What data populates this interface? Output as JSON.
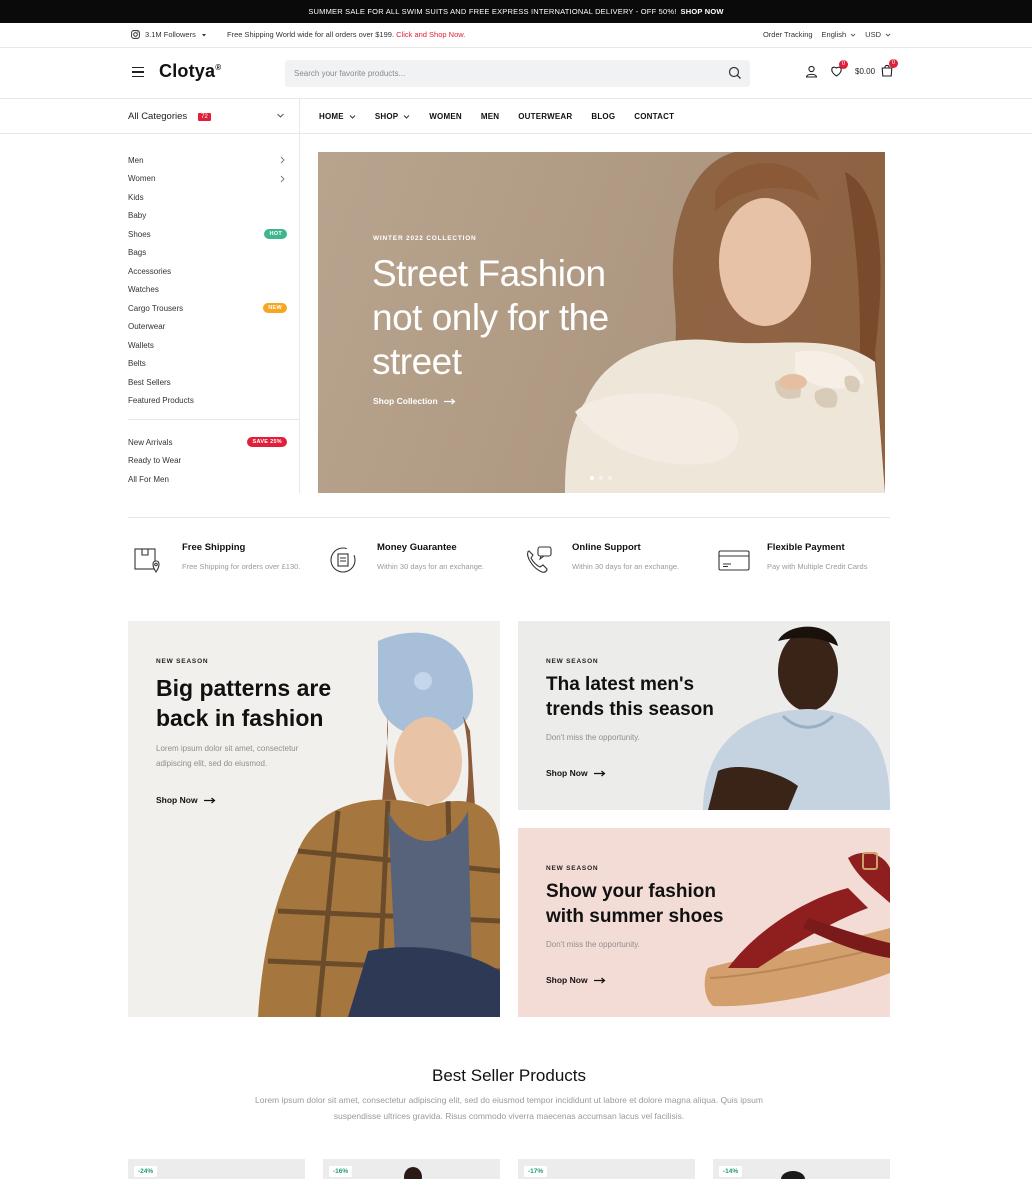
{
  "announcement": {
    "text": "Summer sale for all swim suits and free express international delivery - off 50%!",
    "cta": "Shop now"
  },
  "utility": {
    "followers": "3.1M Followers",
    "shipping_text": "Free Shipping World wide for all orders over $199.",
    "shipping_link": "Click and Shop Now.",
    "order_tracking": "Order Tracking",
    "language": "English",
    "currency": "USD"
  },
  "header": {
    "logo": "Clotya",
    "logo_mark": "®",
    "search_placeholder": "Search your favorite products...",
    "wishlist_count": "0",
    "cart_total": "$0.00",
    "cart_count": "0"
  },
  "nav": {
    "all_categories": "All Categories",
    "categories_count": "72",
    "items": [
      "Home",
      "Shop",
      "Women",
      "Men",
      "Outerwear",
      "Blog",
      "Contact"
    ]
  },
  "sidebar": {
    "categories": [
      {
        "label": "Men"
      },
      {
        "label": "Women"
      },
      {
        "label": "Kids"
      },
      {
        "label": "Baby"
      },
      {
        "label": "Shoes",
        "tag": "HOT"
      },
      {
        "label": "Bags"
      },
      {
        "label": "Accessories"
      },
      {
        "label": "Watches"
      },
      {
        "label": "Cargo Trousers",
        "tag": "NEW"
      },
      {
        "label": "Outerwear"
      },
      {
        "label": "Wallets"
      },
      {
        "label": "Belts"
      },
      {
        "label": "Best Sellers"
      },
      {
        "label": "Featured Products"
      }
    ],
    "extras": [
      {
        "label": "New Arrivals",
        "tag": "SAVE 25%"
      },
      {
        "label": "Ready to Wear"
      },
      {
        "label": "All For Men"
      }
    ]
  },
  "hero": {
    "eyebrow": "Winter 2022 Collection",
    "title": "Street Fashion not only for the street",
    "cta": "Shop Collection"
  },
  "features": [
    {
      "title": "Free Shipping",
      "desc": "Free Shipping for orders over £130.",
      "icon": "package-location-icon"
    },
    {
      "title": "Money Guarantee",
      "desc": "Within 30 days for an exchange.",
      "icon": "money-return-icon"
    },
    {
      "title": "Online Support",
      "desc": "Within 30 days for an exchange.",
      "icon": "support-phone-icon"
    },
    {
      "title": "Flexible Payment",
      "desc": "Pay with Multiple Credit Cards",
      "icon": "credit-card-icon"
    }
  ],
  "banners": [
    {
      "eyebrow": "New Season",
      "title": "Big patterns are back in fashion",
      "desc": "Lorem ipsum dolor sit amet, consectetur adipiscing elit, sed do eiusmod.",
      "cta": "Shop Now"
    },
    {
      "eyebrow": "New Season",
      "title": "Tha latest men's trends this season",
      "desc": "Don't miss the opportunity.",
      "cta": "Shop Now"
    },
    {
      "eyebrow": "New Season",
      "title": "Show your fashion with summer shoes",
      "desc": "Don't miss the opportunity.",
      "cta": "Shop Now"
    }
  ],
  "best_sellers": {
    "title": "Best Seller Products",
    "desc": "Lorem ipsum dolor sit amet, consectetur adipiscing elit, sed do eiusmod tempor incididunt ut labore et dolore magna aliqua. Quis ipsum suspendisse ultrices gravida. Risus commodo viverra maecenas accumsan lacus vel facilisis.",
    "products": [
      {
        "discount": "-24%"
      },
      {
        "discount": "-16%"
      },
      {
        "discount": "-17%"
      },
      {
        "discount": "-14%"
      }
    ]
  },
  "colors": {
    "accent_red": "#e0203a",
    "hot_green": "#3fb68b",
    "new_orange": "#f5a623",
    "discount_green": "#1f9b6e"
  }
}
